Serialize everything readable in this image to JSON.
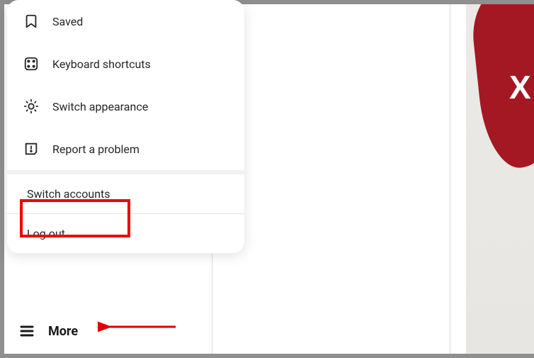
{
  "menu": {
    "items": [
      {
        "icon": "bookmark-icon",
        "label": "Saved"
      },
      {
        "icon": "keyboard-icon",
        "label": "Keyboard shortcuts"
      },
      {
        "icon": "sun-icon",
        "label": "Switch appearance"
      },
      {
        "icon": "alert-icon",
        "label": "Report a problem"
      }
    ],
    "switch_accounts_label": "Switch accounts",
    "logout_label": "Log out"
  },
  "more_label": "More",
  "annotation": {
    "highlight_target": "Switch accounts",
    "arrow_target": "More"
  },
  "colors": {
    "highlight": "#e00000",
    "arrow": "#e00000",
    "shirt": "#a41824"
  }
}
